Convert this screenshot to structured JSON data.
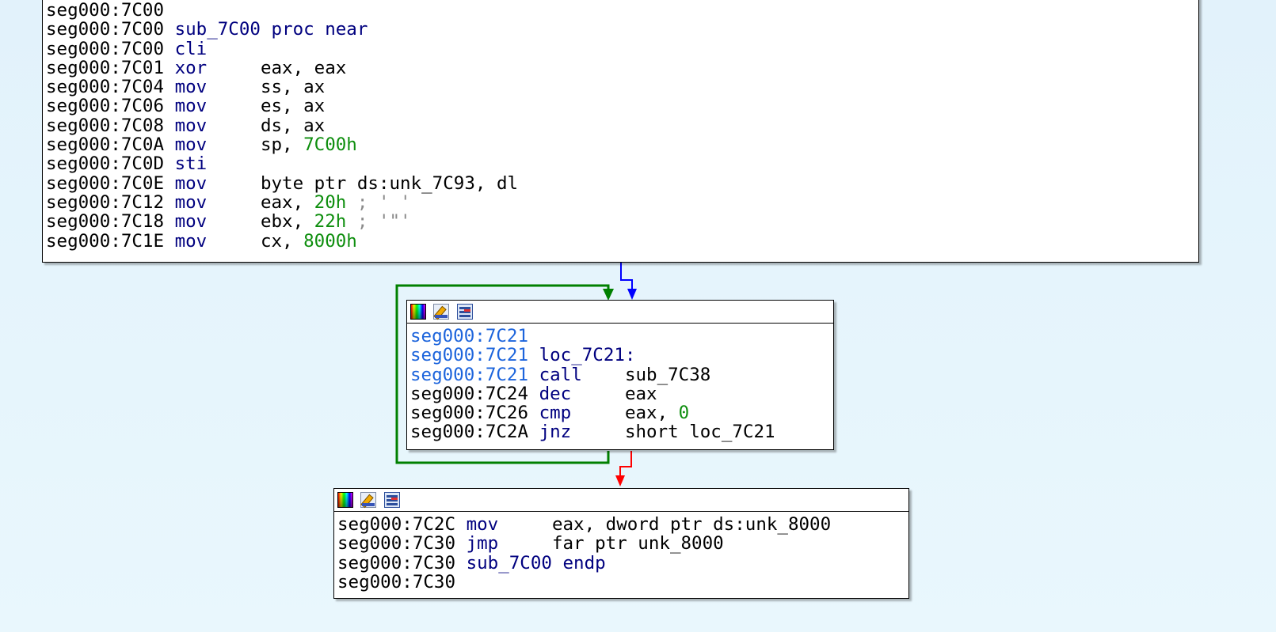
{
  "colors": {
    "background": "#e6f5fc",
    "address": "#000000",
    "address_highlight": "#1c64dc",
    "mnemonic": "#00007f",
    "number": "#0e8e0e",
    "comment": "#8a8a8a",
    "edge_true": "#008000",
    "edge_false": "#ff0000",
    "edge_normal": "#0000ff"
  },
  "block1": {
    "lines": [
      {
        "addr": "seg000:7C00",
        "text": ""
      },
      {
        "addr": "seg000:7C00",
        "text": "sub_7C00 proc near"
      },
      {
        "addr": "seg000:7C00",
        "text": "cli"
      },
      {
        "addr": "seg000:7C01",
        "mnem": "xor",
        "op": "eax, eax"
      },
      {
        "addr": "seg000:7C04",
        "mnem": "mov",
        "op": "ss, ax"
      },
      {
        "addr": "seg000:7C06",
        "mnem": "mov",
        "op": "es, ax"
      },
      {
        "addr": "seg000:7C08",
        "mnem": "mov",
        "op": "ds, ax"
      },
      {
        "addr": "seg000:7C0A",
        "mnem": "mov",
        "op": "sp, ",
        "num": "7C00h"
      },
      {
        "addr": "seg000:7C0D",
        "text": "sti"
      },
      {
        "addr": "seg000:7C0E",
        "mnem": "mov",
        "op": "byte ptr ds:unk_7C93, dl"
      },
      {
        "addr": "seg000:7C12",
        "mnem": "mov",
        "op": "eax, ",
        "num": "20h",
        "comment": " ; ' '"
      },
      {
        "addr": "seg000:7C18",
        "mnem": "mov",
        "op": "ebx, ",
        "num": "22h",
        "comment": " ; '\"'"
      },
      {
        "addr": "seg000:7C1E",
        "mnem": "mov",
        "op": "cx, ",
        "num": "8000h"
      }
    ]
  },
  "block2": {
    "lines": [
      {
        "addr": "seg000:7C21",
        "text": "",
        "hl": true
      },
      {
        "addr": "seg000:7C21",
        "text": "loc_7C21:",
        "hl": true
      },
      {
        "addr": "seg000:7C21",
        "mnem": "call",
        "op": "sub_7C38",
        "hl": true
      },
      {
        "addr": "seg000:7C24",
        "mnem": "dec",
        "op": "eax"
      },
      {
        "addr": "seg000:7C26",
        "mnem": "cmp",
        "op": "eax, ",
        "num": "0"
      },
      {
        "addr": "seg000:7C2A",
        "mnem": "jnz",
        "op": "short loc_7C21"
      }
    ]
  },
  "block3": {
    "lines": [
      {
        "addr": "seg000:7C2C",
        "mnem": "mov",
        "op": "eax, dword ptr ds:unk_8000"
      },
      {
        "addr": "seg000:7C30",
        "mnem": "jmp",
        "op": "far ptr unk_8000"
      },
      {
        "addr": "seg000:7C30",
        "text": "sub_7C00 endp"
      },
      {
        "addr": "seg000:7C30",
        "text": ""
      }
    ]
  },
  "header_icons": [
    "color-palette-icon",
    "edit-icon",
    "graph-view-icon"
  ]
}
